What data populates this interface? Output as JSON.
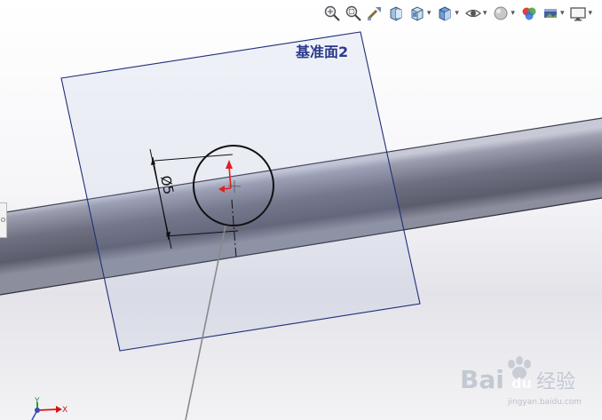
{
  "plane": {
    "label": "基准面2"
  },
  "sketch": {
    "dimension_text": "Ø5"
  },
  "triad": {
    "x_label": "X",
    "y_label": "Y"
  },
  "toolbar": {
    "buttons": [
      {
        "name": "zoom-to-fit-icon"
      },
      {
        "name": "zoom-to-area-icon"
      },
      {
        "name": "previous-view-icon"
      },
      {
        "name": "section-view-icon"
      },
      {
        "name": "view-orientation-icon"
      },
      {
        "name": "display-style-icon"
      },
      {
        "name": "hide-show-items-icon"
      },
      {
        "name": "edit-appearance-icon"
      },
      {
        "name": "apply-scene-icon"
      },
      {
        "name": "view-settings-icon"
      }
    ]
  },
  "watermark": {
    "brand": "Bai",
    "paw": "du",
    "cn": "经验",
    "url": "jingyan.baidu.com"
  },
  "colors": {
    "plane_border": "#1f2f7a",
    "dimension_arrow": "#e02020",
    "rod": "#7b7d8d"
  }
}
